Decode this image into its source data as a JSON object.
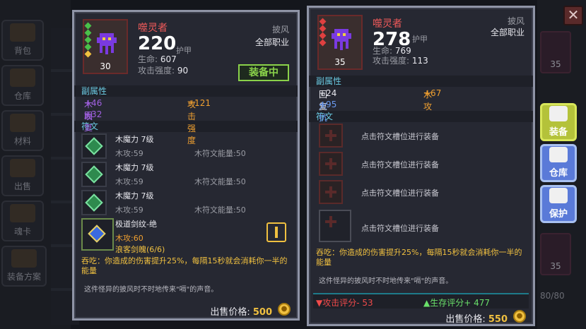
{
  "sidebar": {
    "tabs": [
      "背包",
      "仓库",
      "材料",
      "出售",
      "魂卡",
      "装备方案"
    ]
  },
  "right_slots": {
    "levels": [
      "35",
      "35",
      "35"
    ],
    "counter": "80/80"
  },
  "close_label": "✕",
  "left_card": {
    "name": "噬灵者",
    "armor_value": "220",
    "armor_label": "护甲",
    "level": "30",
    "slot": "披风",
    "class": "全部职业",
    "stats": [
      {
        "label": "生命:",
        "value": "607"
      },
      {
        "label": "攻击强度:",
        "value": "90"
      }
    ],
    "equipped_label": "装备中",
    "sub_attr_header": "副属性",
    "sub_attrs": [
      {
        "label": "木攻",
        "value": "+46",
        "color": "#a060e0"
      },
      {
        "label": "攻击强度",
        "value": "+121",
        "color": "#f0a030"
      },
      {
        "label": "回复",
        "value": "+32",
        "color": "#a060e0"
      }
    ],
    "rune_header": "符文",
    "runes": [
      {
        "title": "木魔力 7级",
        "a": "木攻:59",
        "b": "木符文能量:50"
      },
      {
        "title": "木魔力 7级",
        "a": "木攻:59",
        "b": "木符文能量:50"
      },
      {
        "title": "木魔力 7级",
        "a": "木攻:59",
        "b": "木符文能量:50"
      }
    ],
    "special_rune": {
      "title": "极道剑纹-绝",
      "a": "木攻:60",
      "b": "浪客剑魄(6/6)"
    },
    "effect": "吞吃：你造成的伤害提升25%，每隔15秒就会消耗你一半的能量",
    "flavor": "这件怪异的披风时不时地传来\"嗝\"的声音。",
    "price_label": "出售价格:",
    "price_value": "500"
  },
  "right_card": {
    "name": "噬灵者",
    "armor_value": "278",
    "armor_label": "护甲",
    "level": "35",
    "slot": "披风",
    "class": "全部职业",
    "stats": [
      {
        "label": "生命:",
        "value": "769"
      },
      {
        "label": "攻击强度:",
        "value": "113"
      }
    ],
    "sub_attr_header": "副属性",
    "sub_attrs": [
      {
        "label": "回复",
        "value": "+24",
        "color": "#e8e8ee"
      },
      {
        "label": "水攻",
        "value": "+67",
        "color": "#f0a030"
      },
      {
        "label": "火抗",
        "value": "+95",
        "color": "#6a9af0"
      }
    ],
    "rune_header": "符文",
    "empty_rune_hint": "点击符文槽位进行装备",
    "effect": "吞吃：你造成的伤害提升25%，每隔15秒就会消耗你一半的能量",
    "flavor": "这件怪异的披风时不时地传来\"嗝\"的声音。",
    "score_attack": "▼攻击评分- 53",
    "score_survival": "▲生存评分+ 477",
    "price_label": "出售价格:",
    "price_value": "550"
  },
  "right_menu": [
    "装备",
    "仓库",
    "保护"
  ],
  "colors": {
    "rare_red": "#f05a5a",
    "gold": "#f0c040",
    "equipped_green": "#8ad24a",
    "header_cyan": "#6ac8e0"
  }
}
